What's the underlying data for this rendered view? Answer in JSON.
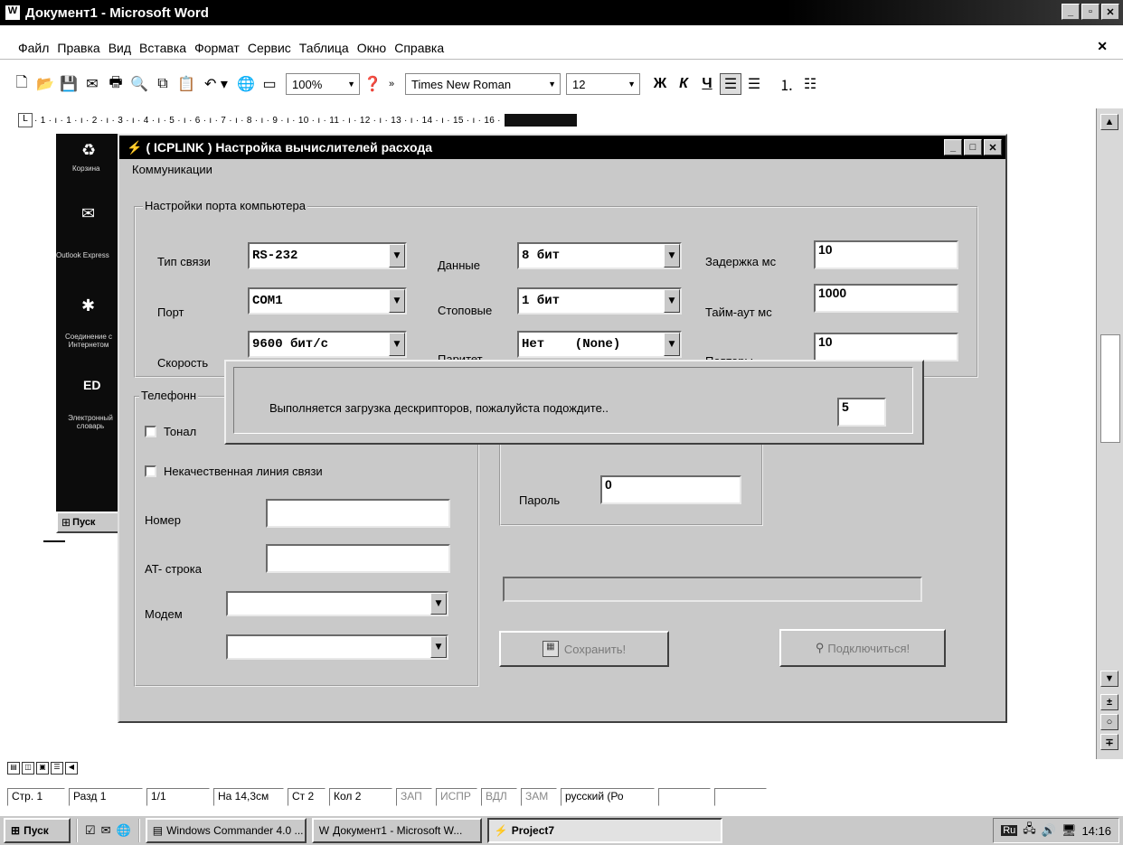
{
  "word": {
    "title": "Документ1 - Microsoft Word",
    "menu": [
      "Файл",
      "Правка",
      "Вид",
      "Вставка",
      "Формат",
      "Сервис",
      "Таблица",
      "Окно",
      "Справка"
    ],
    "zoom": "100%",
    "font_name": "Times New Roman",
    "font_size": "12",
    "ruler_text": "· 1 · ı · 1 · ı · 2 · ı · 3 · ı · 4 · ı · 5 · ı · 6 · ı · 7 · ı · 8 · ı · 9 · ı · 10 · ı · 11 · ı · 12 · ı · 13 · ı · 14 · ı · 15 · ı · 16 ·",
    "desktop_icons": [
      "Корзина",
      "Outlook Express",
      "Соединение с Интернетом",
      "Электронный словарь"
    ],
    "mini_start": "Пуск"
  },
  "status": {
    "page": "Стр. 1",
    "section": "Разд 1",
    "pages": "1/1",
    "position": "На 14,3см",
    "line": "Ст 2",
    "col": "Кол 2",
    "rec": "ЗАП",
    "trk": "ИСПР",
    "ext": "ВДЛ",
    "ovr": "ЗАМ",
    "lang": "русский (Ро"
  },
  "dialog": {
    "title": "( ICPLINK ) Настройка вычислителей расхода",
    "menu": "Коммуникации",
    "port_group": "Настройки порта компьютера",
    "conn_type_label": "Тип связи",
    "conn_type": "RS-232",
    "port_label": "Порт",
    "port": "COM1",
    "speed_label": "Скорость",
    "speed": "9600 бит/с",
    "data_label": "Данные",
    "data": "8 бит",
    "stop_label": "Стоповые",
    "stop": "1 бит",
    "parity_label": "Паритет",
    "parity": "Нет    (None)",
    "delay_label": "Задержка мс",
    "delay": "10",
    "timeout_label": "Тайм-аут мс",
    "timeout": "1000",
    "retries_label": "Повторы",
    "retries": "10",
    "phone_group": "Телефонн",
    "tone_label": "Тонал",
    "bad_line_label": "Некачественная линия связи",
    "number_label": "Номер",
    "number": "",
    "at_label": "AT- строка",
    "at": "",
    "modem_label": "Модем",
    "modem": "",
    "modem2": "",
    "password_label": "Пароль",
    "password": "0",
    "save_button": "Сохранить!",
    "connect_button": "Подключиться!"
  },
  "loading": {
    "message": "Выполняется загрузка дескрипторов, пожалуйста подождите..",
    "count": "5"
  },
  "taskbar": {
    "start": "Пуск",
    "tasks": [
      "Windows Commander 4.0 ...",
      "Документ1 - Microsoft W...",
      "Project7"
    ],
    "clock": "14:16"
  }
}
